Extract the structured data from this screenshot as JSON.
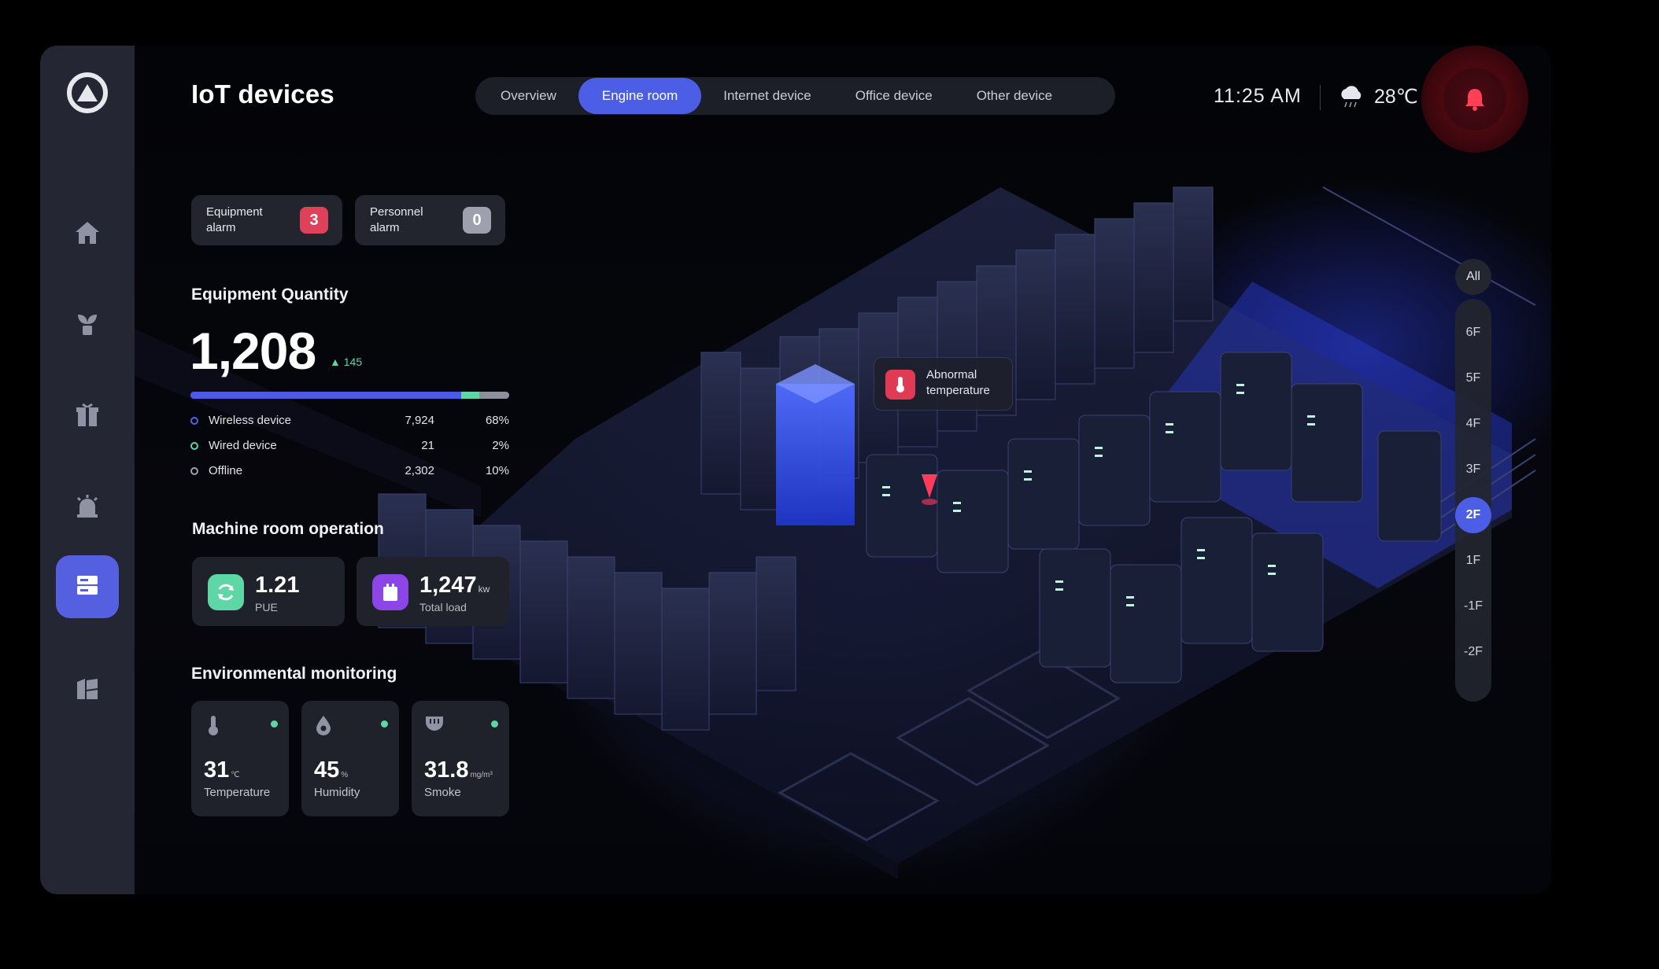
{
  "header": {
    "title": "IoT devices",
    "tabs": [
      "Overview",
      "Engine room",
      "Internet device",
      "Office device",
      "Other device"
    ],
    "active_tab": "Engine room",
    "time": "11:25 AM",
    "temperature": "28℃",
    "weather_icon": "cloud-rain-icon",
    "bell_icon": "bell-icon"
  },
  "sidebar": {
    "items": [
      {
        "icon": "home-icon"
      },
      {
        "icon": "plant-icon"
      },
      {
        "icon": "gift-box-icon"
      },
      {
        "icon": "alarm-light-icon"
      },
      {
        "icon": "server-icon",
        "active": true
      },
      {
        "icon": "map-icon"
      }
    ]
  },
  "alarms": {
    "equipment": {
      "label": "Equipment alarm",
      "count": "3",
      "color": "#e0415a"
    },
    "personnel": {
      "label": "Personnel alarm",
      "count": "0",
      "color": "#9ea1ad"
    }
  },
  "equipment_quantity": {
    "heading": "Equipment Quantity",
    "total": "1,208",
    "delta": "145",
    "bar_fractions": {
      "wireless": 0.68,
      "wired": 0.02,
      "offline": 0.1
    },
    "rows": [
      {
        "name": "Wireless device",
        "count": "7,924",
        "pct": "68%",
        "color": "#5160e8"
      },
      {
        "name": "Wired device",
        "count": "21",
        "pct": "2%",
        "color": "#5fd6a6"
      },
      {
        "name": "Offline",
        "count": "2,302",
        "pct": "10%",
        "color": "#9ea1ad"
      }
    ]
  },
  "machine_room": {
    "heading": "Machine room operation",
    "pue": {
      "value": "1.21",
      "label": "PUE",
      "icon": "refresh-icon",
      "color": "#5fd6a6"
    },
    "load": {
      "value": "1,247",
      "unit": "kw",
      "label": "Total load",
      "icon": "battery-icon",
      "color": "#8c45e6"
    }
  },
  "environment": {
    "heading": "Environmental monitoring",
    "items": [
      {
        "value": "31",
        "unit": "℃",
        "label": "Temperature",
        "icon": "thermometer-icon"
      },
      {
        "value": "45",
        "unit": "%",
        "label": "Humidity",
        "icon": "droplet-icon"
      },
      {
        "value": "31.8",
        "unit": "mg/m³",
        "label": "Smoke",
        "icon": "smoke-detector-icon"
      }
    ]
  },
  "floors": {
    "all_label": "All",
    "items": [
      "6F",
      "5F",
      "4F",
      "3F",
      "2F",
      "1F",
      "-1F",
      "-2F"
    ],
    "active": "2F"
  },
  "tooltip": {
    "text": "Abnormal temperature",
    "icon": "thermometer-icon"
  }
}
